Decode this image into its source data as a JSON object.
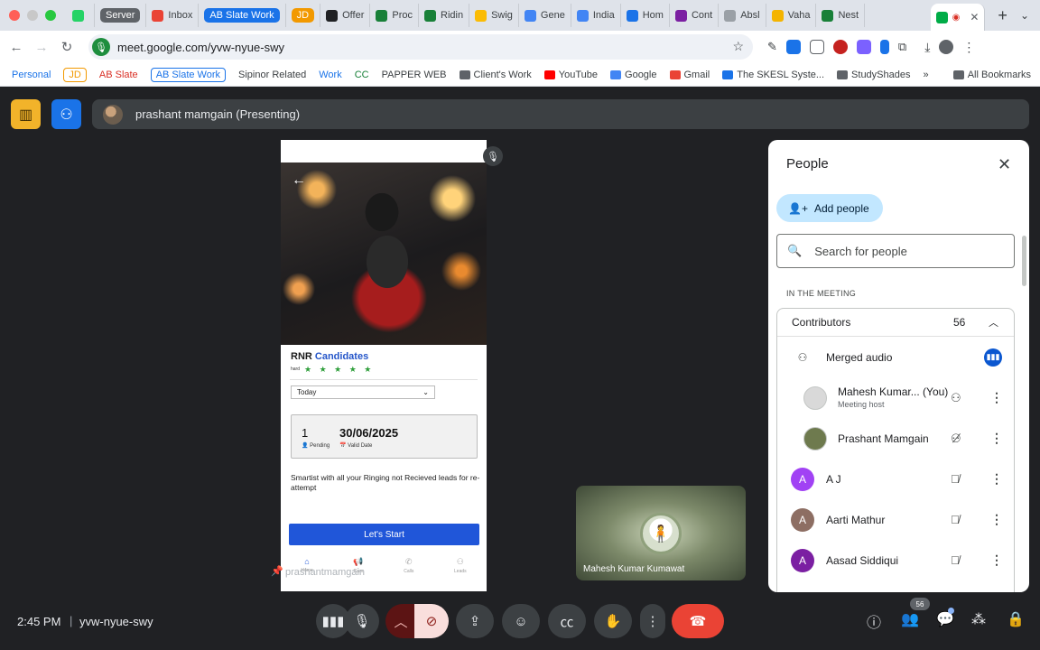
{
  "browser": {
    "tabs": [
      {
        "label": "",
        "color": "#25d366"
      },
      {
        "label": "Server",
        "chip": "#5f6368"
      },
      {
        "label": "Inbox",
        "color": "#ea4335"
      },
      {
        "label": "AB Slate Work",
        "chip": "#1a73e8"
      },
      {
        "label": "JD",
        "chip": "#f29900"
      },
      {
        "label": "Offer",
        "color": "#202124"
      },
      {
        "label": "Proc",
        "color": "#188038"
      },
      {
        "label": "Ridin",
        "color": "#188038"
      },
      {
        "label": "Swig",
        "color": "#fbbc04"
      },
      {
        "label": "Gene",
        "color": "#4285f4"
      },
      {
        "label": "India",
        "color": "#4285f4"
      },
      {
        "label": "Hom",
        "color": "#1a73e8"
      },
      {
        "label": "Cont",
        "color": "#7b1fa2"
      },
      {
        "label": "Absl",
        "color": "#9aa0a6"
      },
      {
        "label": "Vaha",
        "color": "#f4b400"
      },
      {
        "label": "Nest",
        "color": "#188038"
      }
    ],
    "url": "meet.google.com/yvw-nyue-swy",
    "bookmarks": [
      {
        "label": "Personal",
        "color": "#1a73e8"
      },
      {
        "label": "JD",
        "chip": "#f29900"
      },
      {
        "label": "AB Slate",
        "color": "#d93025"
      },
      {
        "label": "AB Slate Work",
        "chip": "#1a73e8"
      },
      {
        "label": "Sipinor Related",
        "color": "#3c4043"
      },
      {
        "label": "Work",
        "color": "#1a73e8"
      },
      {
        "label": "CC",
        "color": "#188038"
      },
      {
        "label": "PAPPER WEB",
        "color": "#3c4043"
      },
      {
        "label": "Client's Work",
        "icon": "folder"
      },
      {
        "label": "YouTube",
        "icon": "youtube"
      },
      {
        "label": "Google",
        "icon": "google"
      },
      {
        "label": "Gmail",
        "icon": "gmail"
      },
      {
        "label": "The SKESL Syste...",
        "icon": "s"
      },
      {
        "label": "StudyShades",
        "icon": "folder"
      }
    ],
    "all_bookmarks": "All Bookmarks"
  },
  "meet": {
    "presenting_text": "prashant mamgain (Presenting)",
    "share": {
      "title_part1": "RNR",
      "title_part2": "Candidates",
      "hard_label": "hard",
      "stars": "★ ★ ★ ★ ★",
      "filter_value": "Today",
      "pending_count": "1",
      "pending_label": "Pending",
      "valid_date": "30/06/2025",
      "valid_label": "Valid Date",
      "description": "Smartist with all your Ringing not Recieved leads for re-attempt",
      "start_button": "Let's Start",
      "nav": [
        {
          "label": "Home",
          "icon": "⌂"
        },
        {
          "label": "Cam",
          "icon": "📢"
        },
        {
          "label": "Calls",
          "icon": "✆"
        },
        {
          "label": "Leads",
          "icon": "⚇"
        }
      ],
      "presenter_name": "prashantmamgain"
    },
    "self_tile_name": "Mahesh Kumar Kumawat",
    "people": {
      "title": "People",
      "add_people": "Add people",
      "search_placeholder": "Search for people",
      "in_meeting": "IN THE MEETING",
      "contributors_label": "Contributors",
      "contributors_count": "56",
      "rows": [
        {
          "name": "Merged audio",
          "avatar": "",
          "avatar_color": "#ffffff",
          "status": "audio"
        },
        {
          "name": "Mahesh Kumar... (You)",
          "role": "Meeting host",
          "avatar": "",
          "avatar_color": "#d9d9d9",
          "status": "pin",
          "indent": true
        },
        {
          "name": "Prashant Mamgain",
          "avatar": "",
          "avatar_color": "#6e7a4e",
          "status": "pin-off",
          "indent": true
        },
        {
          "name": "A J",
          "avatar": "A",
          "avatar_color": "#a142f4",
          "status": "mic-off"
        },
        {
          "name": "Aarti Mathur",
          "avatar": "A",
          "avatar_color": "#8d6e63",
          "status": "mic-off"
        },
        {
          "name": "Aasad Siddiqui",
          "avatar": "A",
          "avatar_color": "#7b1fa2",
          "status": "mic-off"
        }
      ]
    },
    "footer": {
      "time": "2:45 PM",
      "meeting_code": "yvw-nyue-swy",
      "people_badge": "56"
    }
  }
}
